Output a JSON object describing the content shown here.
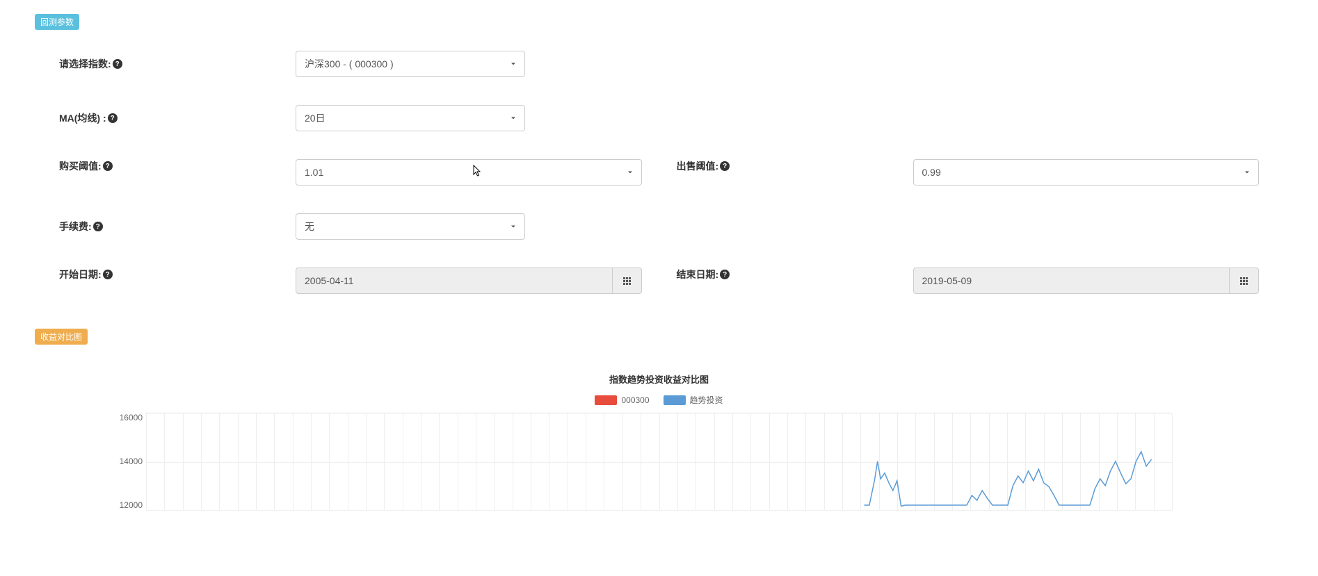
{
  "badges": {
    "params": "回测参数",
    "chart": "收益对比图"
  },
  "form": {
    "index": {
      "label": "请选择指数:",
      "value": "沪深300 - ( 000300 )"
    },
    "ma": {
      "label": "MA(均线) :",
      "value": "20日"
    },
    "buy_threshold": {
      "label": "购买阈值:",
      "value": "1.01"
    },
    "sell_threshold": {
      "label": "出售阈值:",
      "value": "0.99"
    },
    "fee": {
      "label": "手续费:",
      "value": "无"
    },
    "start_date": {
      "label": "开始日期:",
      "value": "2005-04-11"
    },
    "end_date": {
      "label": "结束日期:",
      "value": "2019-05-09"
    }
  },
  "chart_data": {
    "type": "line",
    "title": "指数趋势投资收益对比图",
    "series": [
      {
        "name": "000300",
        "color": "#e74c3c"
      },
      {
        "name": "趋势投资",
        "color": "#5b9bd5"
      }
    ],
    "ylim": [
      12000,
      16000
    ],
    "yticks": [
      16000,
      14000,
      12000
    ],
    "visible_line": {
      "series": "趋势投资",
      "points_pct": [
        [
          70,
          95
        ],
        [
          70.5,
          95
        ],
        [
          71,
          70
        ],
        [
          71.3,
          50
        ],
        [
          71.6,
          68
        ],
        [
          72,
          62
        ],
        [
          72.4,
          72
        ],
        [
          72.8,
          80
        ],
        [
          73.2,
          70
        ],
        [
          73.6,
          96
        ],
        [
          74,
          95
        ],
        [
          74,
          95
        ],
        [
          80,
          95
        ],
        [
          80,
          95
        ],
        [
          80.5,
          85
        ],
        [
          81,
          90
        ],
        [
          81.5,
          80
        ],
        [
          82,
          88
        ],
        [
          82.5,
          95
        ],
        [
          82.5,
          95
        ],
        [
          84,
          95
        ],
        [
          84,
          95
        ],
        [
          84.5,
          75
        ],
        [
          85,
          65
        ],
        [
          85.5,
          72
        ],
        [
          86,
          60
        ],
        [
          86.5,
          70
        ],
        [
          87,
          58
        ],
        [
          87.5,
          72
        ],
        [
          88,
          76
        ],
        [
          88.5,
          85
        ],
        [
          89,
          95
        ],
        [
          89,
          95
        ],
        [
          92,
          95
        ],
        [
          92,
          95
        ],
        [
          92.5,
          78
        ],
        [
          93,
          68
        ],
        [
          93.5,
          75
        ],
        [
          94,
          60
        ],
        [
          94.5,
          50
        ],
        [
          95,
          62
        ],
        [
          95.5,
          73
        ],
        [
          96,
          68
        ],
        [
          96.5,
          50
        ],
        [
          97,
          40
        ],
        [
          97.5,
          55
        ],
        [
          98,
          48
        ]
      ]
    }
  }
}
